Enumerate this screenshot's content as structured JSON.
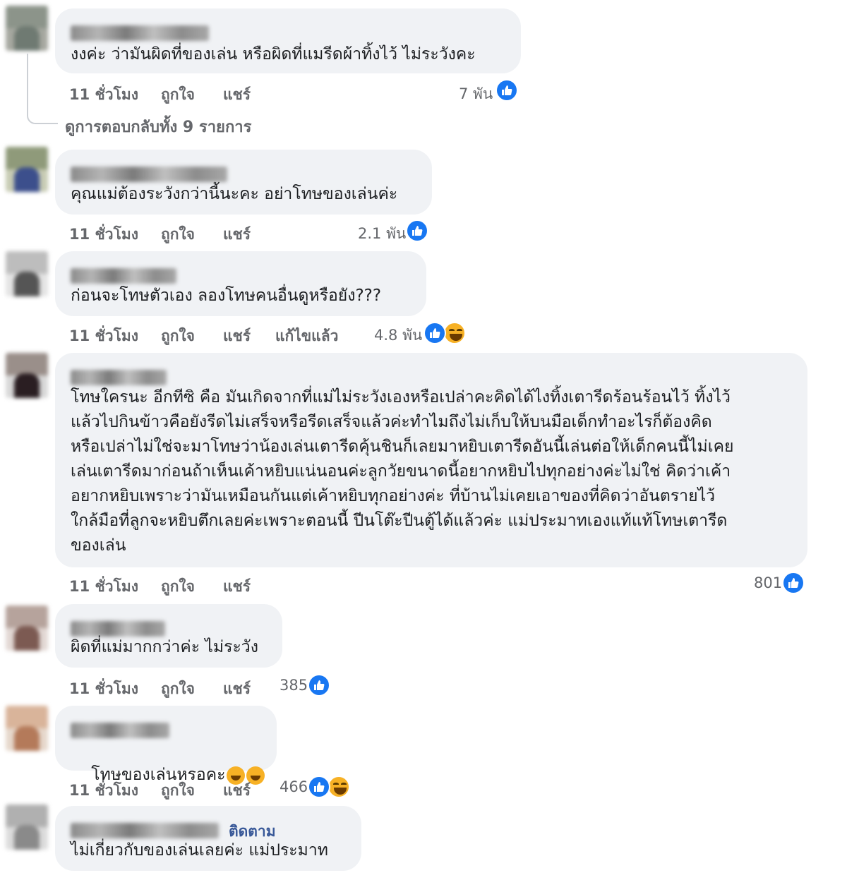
{
  "actions": {
    "time": "11 ชั่วโมง",
    "like": "ถูกใจ",
    "share": "แชร์",
    "edited": "แก้ไขแล้ว"
  },
  "thread": {
    "view_replies": "ดูการตอบกลับทั้ง 9 รายการ"
  },
  "comments": [
    {
      "text": "งงค่ะ ว่ามันผิดที่ของเล่น หรือผิดที่แมรีดผ้าทิ้งไว้ ไม่ระวังคะ",
      "reactions": "7 พัน"
    },
    {
      "text": "คุณแม่ต้องระวังกว่านี้นะคะ อย่าโทษของเล่นค่ะ",
      "reactions": "2.1 พัน"
    },
    {
      "text": "ก่อนจะโทษตัวเอง ลองโทษคนอื่นดูหรือยัง???",
      "reactions": "4.8 พัน"
    },
    {
      "text": "โทษใครนะ อีกทีซิ คือ มันเกิดจากที่แม่ไม่ระวังเองหรือเปล่าคะคิดได้ไงทิ้งเตารีดร้อนร้อนไว้ ทิ้งไว้\nแล้วไปกินข้าวคือยังรีดไม่เสร็จหรือรีดเสร็จแล้วค่ะทำไมถึงไม่เก็บให้บนมือเด็กทำอะไรก็ต้องคิด\nหรือเปล่าไม่ใช่จะมาโทษว่าน้องเล่นเตารีดคุ้นชินก็เลยมาหยิบเตารีดอันนี้เล่นต่อให้เด็กคนนี้ไม่เคย\nเล่นเตารีดมาก่อนถ้าเห็นเค้าหยิบแน่นอนค่ะลูกวัยขนาดนี้อยากหยิบไปทุกอย่างค่ะไม่ใช่ คิดว่าเค้า\nอยากหยิบเพราะว่ามันเหมือนกันแต่เค้าหยิบทุกอย่างค่ะ ที่บ้านไม่เคยเอาของที่คิดว่าอันตรายไว้\nใกล้มือที่ลูกจะหยิบตึกเลยค่ะเพราะตอนนี้ ปีนโต๊ะปีนตู้ได้แล้วค่ะ แม่ประมาทเองแท้แท้โทษเตารีด\nของเล่น",
      "reactions": "801"
    },
    {
      "text": "ผิดที่แม่มากกว่าค่ะ ไม่ระวัง",
      "reactions": "385"
    },
    {
      "text": "โทษของเล่นหรอคะ",
      "reactions": "466"
    },
    {
      "text": "ไม่เกี่ยวกับของเล่นเลยค่ะ แม่ประมาท",
      "follow": "ติดตาม"
    }
  ]
}
